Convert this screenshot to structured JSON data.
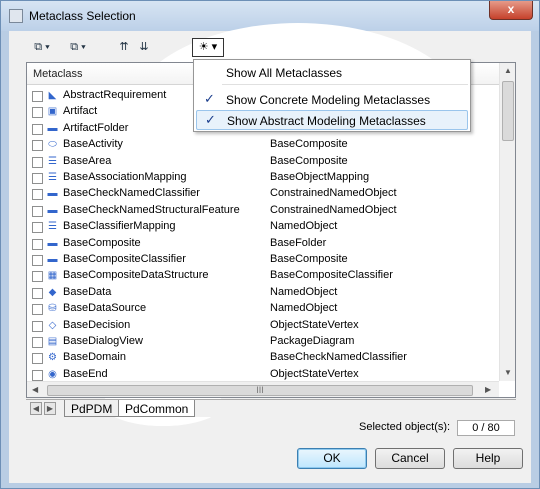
{
  "window": {
    "title": "Metaclass Selection",
    "close": "x"
  },
  "toolbar": {
    "btn1": "⧉ ▾",
    "btn2": "⧉ ▾",
    "btn3": "⇈",
    "btn4": "⇊",
    "filter": "☀ ▾"
  },
  "list": {
    "header": "Metaclass",
    "rows": [
      {
        "icon": "◣",
        "name": "AbstractRequirement",
        "parent": ""
      },
      {
        "icon": "▣",
        "name": "Artifact",
        "parent": ""
      },
      {
        "icon": "▬",
        "name": "ArtifactFolder",
        "parent": ""
      },
      {
        "icon": "⬭",
        "name": "BaseActivity",
        "parent": "BaseComposite"
      },
      {
        "icon": "☰",
        "name": "BaseArea",
        "parent": "BaseComposite"
      },
      {
        "icon": "☰",
        "name": "BaseAssociationMapping",
        "parent": "BaseObjectMapping"
      },
      {
        "icon": "▬",
        "name": "BaseCheckNamedClassifier",
        "parent": "ConstrainedNamedObject"
      },
      {
        "icon": "▬",
        "name": "BaseCheckNamedStructuralFeature",
        "parent": "ConstrainedNamedObject"
      },
      {
        "icon": "☰",
        "name": "BaseClassifierMapping",
        "parent": "NamedObject"
      },
      {
        "icon": "▬",
        "name": "BaseComposite",
        "parent": "BaseFolder"
      },
      {
        "icon": "▬",
        "name": "BaseCompositeClassifier",
        "parent": "BaseComposite"
      },
      {
        "icon": "▦",
        "name": "BaseCompositeDataStructure",
        "parent": "BaseCompositeClassifier"
      },
      {
        "icon": "◆",
        "name": "BaseData",
        "parent": "NamedObject"
      },
      {
        "icon": "⛁",
        "name": "BaseDataSource",
        "parent": "NamedObject"
      },
      {
        "icon": "◇",
        "name": "BaseDecision",
        "parent": "ObjectStateVertex"
      },
      {
        "icon": "▤",
        "name": "BaseDialogView",
        "parent": "PackageDiagram"
      },
      {
        "icon": "⚙",
        "name": "BaseDomain",
        "parent": "BaseCheckNamedClassifier"
      },
      {
        "icon": "◉",
        "name": "BaseEnd",
        "parent": "ObjectStateVertex"
      }
    ],
    "hscroll_grip": "III"
  },
  "tabs": [
    {
      "label": "PdPDM"
    },
    {
      "label": "PdCommon"
    }
  ],
  "status": {
    "selected_label": "Selected object(s):",
    "count": "0 / 80"
  },
  "buttons": {
    "ok": "OK",
    "cancel": "Cancel",
    "help": "Help"
  },
  "menu": {
    "items": [
      {
        "label": "Show All Metaclasses",
        "checked": ""
      },
      {
        "label": "Show Concrete Modeling Metaclasses",
        "checked": "✓"
      },
      {
        "label": "Show Abstract Modeling Metaclasses",
        "checked": "✓"
      }
    ]
  },
  "colors": {
    "accent": "#1a3d8c",
    "titlebar": "#bcd0e8",
    "close": "#c5412b"
  }
}
